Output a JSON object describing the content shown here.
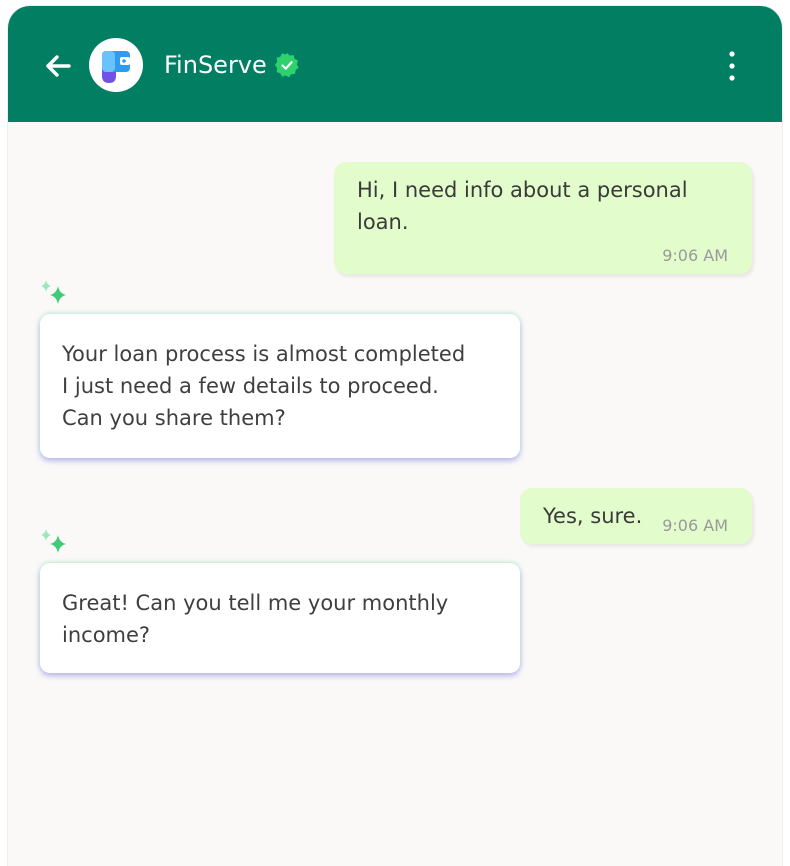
{
  "header": {
    "title": "FinServe",
    "colors": {
      "header_bg": "#027e63",
      "verified": "#2fd16d"
    },
    "icons": [
      "back-arrow-icon",
      "wallet-logo-icon",
      "verified-badge-icon",
      "more-vert-icon"
    ]
  },
  "messages": [
    {
      "direction": "outgoing",
      "text": "Hi, I need info about a personal loan.",
      "time": "9:06 AM"
    },
    {
      "direction": "incoming",
      "text": "Your loan process is almost completed\n I just need a few details to proceed.\nCan you share them?"
    },
    {
      "direction": "outgoing",
      "text": "Yes, sure.",
      "time": "9:06 AM"
    },
    {
      "direction": "incoming",
      "text": "Great! Can you tell me your monthly\nincome?"
    }
  ],
  "colors": {
    "outgoing_bubble": "#e2fccb",
    "incoming_bubble": "#ffffff",
    "chat_bg": "#faf9f8"
  }
}
